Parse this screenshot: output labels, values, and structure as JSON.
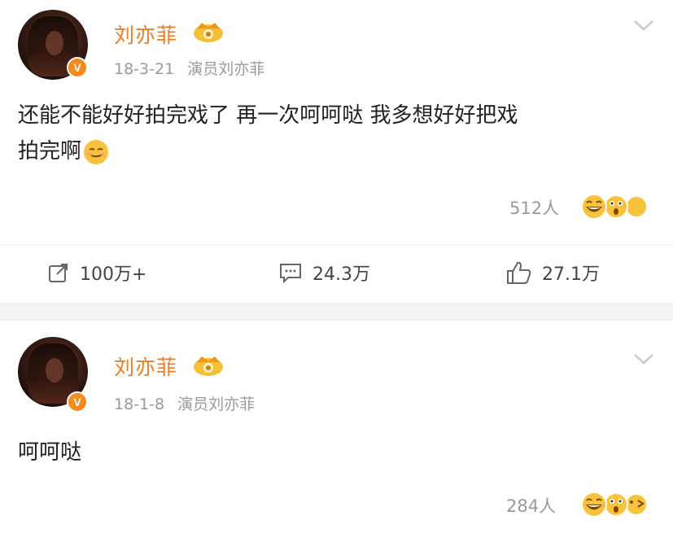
{
  "posts": [
    {
      "author": "刘亦菲",
      "date": "18-3-21",
      "source": "演员刘亦菲",
      "text_line1": "还能不能好好拍完戏了 再一次呵呵哒 我多想好好把戏",
      "text_line2": "拍完啊",
      "reaction_count": "512人",
      "repost_count": "100万+",
      "comment_count": "24.3万",
      "like_count": "27.1万"
    },
    {
      "author": "刘亦菲",
      "date": "18-1-8",
      "source": "演员刘亦菲",
      "text_line1": "呵呵哒",
      "reaction_count": "284人"
    }
  ],
  "colors": {
    "accent": "#f07d1f",
    "muted": "#9a9a9a",
    "badge": "#f58a1f"
  },
  "icons": [
    "crown-badge-icon",
    "verified-v-icon",
    "chevron-down-icon",
    "repost-icon",
    "comment-icon",
    "like-icon",
    "emoji-icon"
  ]
}
